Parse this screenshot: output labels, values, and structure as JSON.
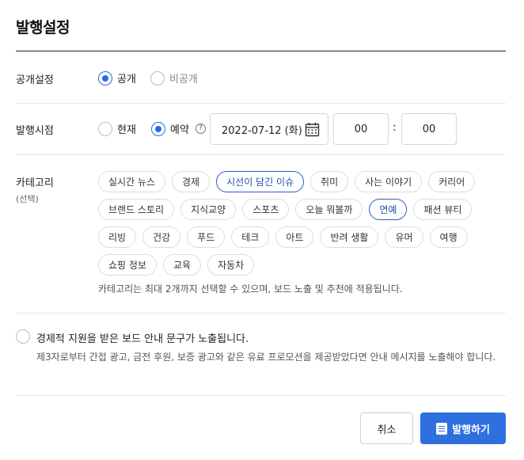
{
  "title": "발행설정",
  "visibility": {
    "label": "공개설정",
    "options": [
      "공개",
      "비공개"
    ],
    "selected": "공개"
  },
  "publish_time": {
    "label": "발행시점",
    "options": [
      "현재",
      "예약"
    ],
    "selected": "예약",
    "help_icon": "?",
    "date": "2022-07-12 (화)",
    "hour": "00",
    "minute": "00",
    "separator": ":"
  },
  "category": {
    "label": "카테고리",
    "sublabel": "(선택)",
    "rows": [
      [
        "실시간 뉴스",
        "경제",
        "시선이 담긴 이슈",
        "취미",
        "사는 이야기",
        "커리어"
      ],
      [
        "브랜드 스토리",
        "지식교양",
        "스포츠",
        "오늘 뭐볼까",
        "연예",
        "패션 뷰티"
      ],
      [
        "리빙",
        "건강",
        "푸드",
        "테크",
        "아트",
        "반려 생활",
        "유머",
        "여행"
      ],
      [
        "쇼핑 정보",
        "교육",
        "자동차"
      ]
    ],
    "selected": [
      "시선이 담긴 이슈",
      "연예"
    ],
    "note": "카테고리는 최대 2개까지 선택할 수 있으며, 보드 노출 및 추천에 적용됩니다."
  },
  "sponsorship": {
    "title": "경제적 지원을 받은 보드 안내 문구가 노출됩니다.",
    "description": "제3자로부터 간접 광고, 금전 후원, 보증 광고와 같은 유료 프로모션을 제공받았다면 안내 메시지를 노출해야 합니다."
  },
  "buttons": {
    "cancel": "취소",
    "publish": "발행하기"
  },
  "colors": {
    "accent": "#2f6fe0",
    "selected_chip": "#2a5fc0"
  }
}
